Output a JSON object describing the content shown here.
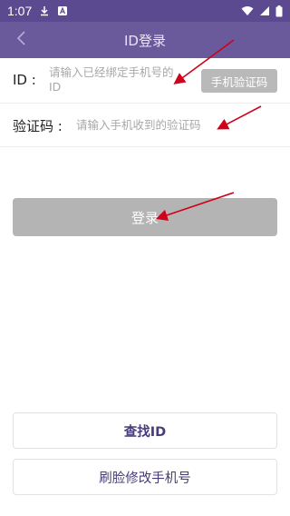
{
  "status_bar": {
    "time": "1:07",
    "icons": [
      "download-icon",
      "notification-a-icon",
      "wifi-icon",
      "signal-icon",
      "battery-icon"
    ]
  },
  "app_bar": {
    "title": "ID登录",
    "back_icon": "back-arrow-icon"
  },
  "form": {
    "id_label": "ID :",
    "id_placeholder": "请输入已经绑定手机号的ID",
    "sms_button_label": "手机验证码",
    "code_label": "验证码 :",
    "code_placeholder": "请输入手机收到的验证码"
  },
  "login_button_label": "登录",
  "find_id_label": "查找ID",
  "face_change_phone_label": "刷脸修改手机号",
  "colors": {
    "status_bar": "#5b4a8f",
    "app_bar": "#6a5a9c",
    "button_disabled": "#b4b4b4",
    "accent_text": "#4a3c7a",
    "annotation_arrow": "#d0021b"
  }
}
